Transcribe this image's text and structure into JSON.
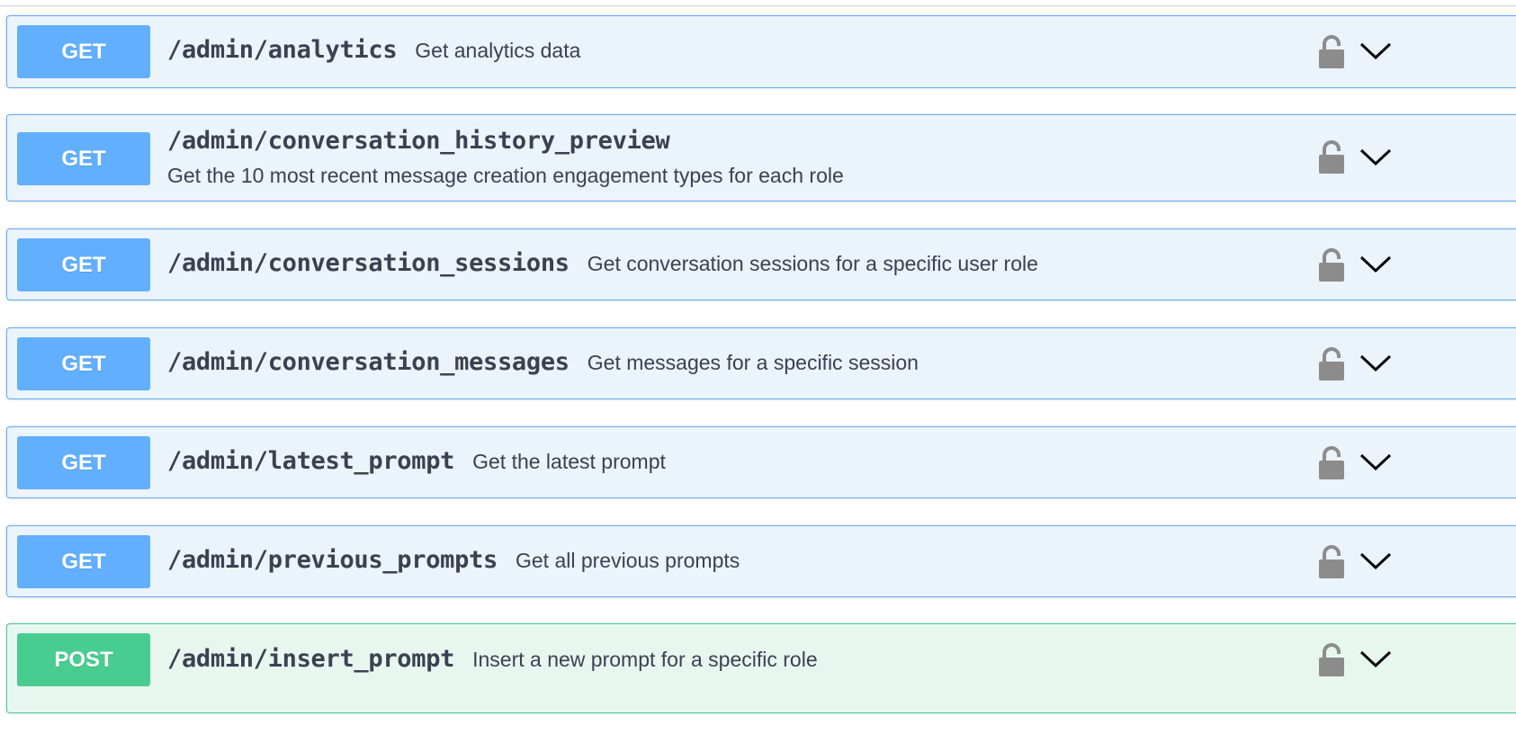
{
  "endpoints": [
    {
      "method": "GET",
      "path": "/admin/analytics",
      "description": "Get analytics data",
      "icons": [
        "lock-icon",
        "chevron-down-icon"
      ]
    },
    {
      "method": "GET",
      "path": "/admin/conversation_history_preview",
      "description": "Get the 10 most recent message creation engagement types for each role",
      "icons": [
        "lock-icon",
        "chevron-down-icon"
      ]
    },
    {
      "method": "GET",
      "path": "/admin/conversation_sessions",
      "description": "Get conversation sessions for a specific user role",
      "icons": [
        "lock-icon",
        "chevron-down-icon"
      ]
    },
    {
      "method": "GET",
      "path": "/admin/conversation_messages",
      "description": "Get messages for a specific session",
      "icons": [
        "lock-icon",
        "chevron-down-icon"
      ]
    },
    {
      "method": "GET",
      "path": "/admin/latest_prompt",
      "description": "Get the latest prompt",
      "icons": [
        "lock-icon",
        "chevron-down-icon"
      ]
    },
    {
      "method": "GET",
      "path": "/admin/previous_prompts",
      "description": "Get all previous prompts",
      "icons": [
        "lock-icon",
        "chevron-down-icon"
      ]
    },
    {
      "method": "POST",
      "path": "/admin/insert_prompt",
      "description": "Insert a new prompt for a specific role",
      "icons": [
        "lock-icon",
        "chevron-down-icon"
      ]
    }
  ],
  "colors": {
    "get_accent": "#61affe",
    "get_background": "#ebf3fb",
    "post_accent": "#49cc90",
    "post_background": "#e8f6f0",
    "text": "#3b4151",
    "icon": "#8c8c8c"
  }
}
